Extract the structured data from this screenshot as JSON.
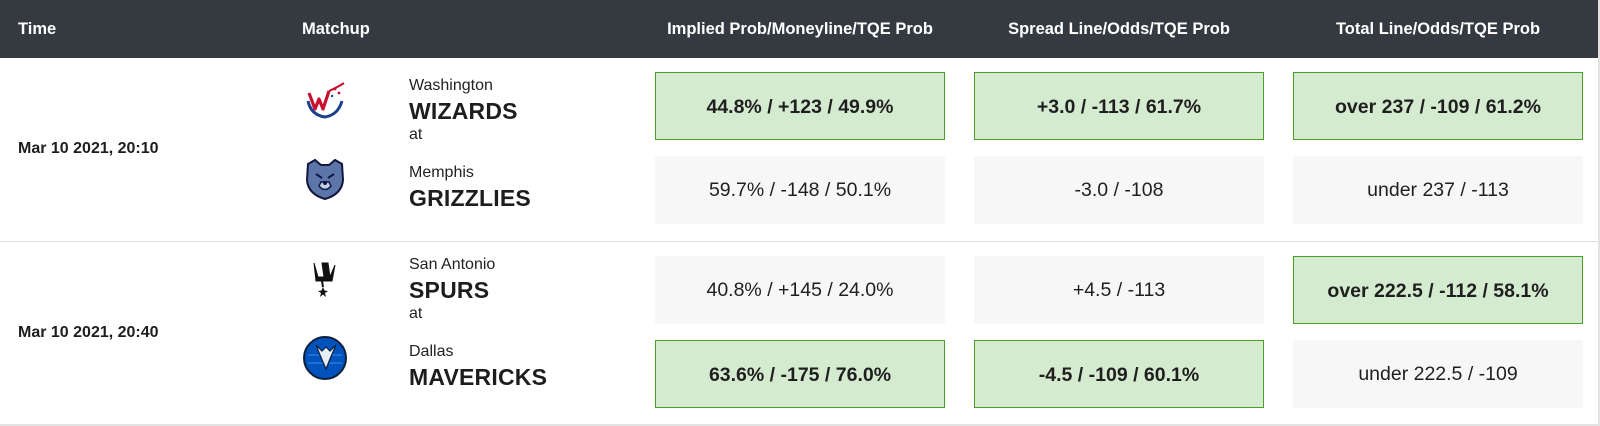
{
  "header": {
    "time": "Time",
    "matchup": "Matchup",
    "implied": "Implied Prob/Moneyline/TQE Prob",
    "spread": "Spread Line/Odds/TQE Prob",
    "total": "Total Line/Odds/TQE Prob"
  },
  "games": [
    {
      "time": "Mar 10 2021, 20:10",
      "at": "at",
      "away": {
        "city": "Washington",
        "team": "WIZARDS",
        "logo": "wizards-logo-icon"
      },
      "home": {
        "city": "Memphis",
        "team": "GRIZZLIES",
        "logo": "grizzlies-logo-icon"
      },
      "away_odds": {
        "moneyline": "44.8% / +123 / 49.9%",
        "moneyline_highlight": true,
        "spread": "+3.0 / -113 / 61.7%",
        "spread_highlight": true,
        "total": "over 237 / -109 / 61.2%",
        "total_highlight": true
      },
      "home_odds": {
        "moneyline": "59.7% / -148 / 50.1%",
        "moneyline_highlight": false,
        "spread": "-3.0 / -108",
        "spread_highlight": false,
        "total": "under 237 / -113",
        "total_highlight": false
      }
    },
    {
      "time": "Mar 10 2021, 20:40",
      "at": "at",
      "away": {
        "city": "San Antonio",
        "team": "SPURS",
        "logo": "spurs-logo-icon"
      },
      "home": {
        "city": "Dallas",
        "team": "MAVERICKS",
        "logo": "mavericks-logo-icon"
      },
      "away_odds": {
        "moneyline": "40.8% / +145 / 24.0%",
        "moneyline_highlight": false,
        "spread": "+4.5 / -113",
        "spread_highlight": false,
        "total": "over 222.5 / -112 / 58.1%",
        "total_highlight": true
      },
      "home_odds": {
        "moneyline": "63.6% / -175 / 76.0%",
        "moneyline_highlight": true,
        "spread": "-4.5 / -109 / 60.1%",
        "spread_highlight": true,
        "total": "under 222.5 / -109",
        "total_highlight": false
      }
    }
  ],
  "colors": {
    "header_bg": "#343a40",
    "highlight_bg": "#d4ebd0",
    "highlight_border": "#4a9d2f",
    "cell_bg": "#f7f7f7"
  }
}
